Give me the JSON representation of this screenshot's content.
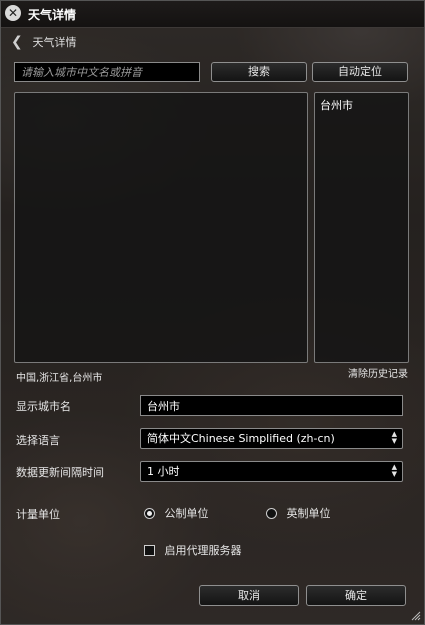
{
  "window": {
    "title": "天气详情"
  },
  "nav": {
    "back_icon": "chevron-left-icon",
    "title": "天气详情"
  },
  "search": {
    "placeholder": "请输入城市中文名或拼音",
    "search_button": "搜索",
    "locate_button": "自动定位"
  },
  "history": {
    "items": [
      "台州市"
    ],
    "clear_label": "清除历史记录"
  },
  "location": {
    "selected": "中国,浙江省,台州市"
  },
  "form": {
    "display_city_label": "显示城市名",
    "display_city_value": "台州市",
    "language_label": "选择语言",
    "language_value": "简体中文Chinese Simplified (zh-cn)",
    "interval_label": "数据更新间隔时间",
    "interval_value": "1 小时",
    "unit_label": "计量单位",
    "unit_options": [
      {
        "label": "公制单位",
        "selected": true
      },
      {
        "label": "英制单位",
        "selected": false
      }
    ],
    "proxy_label": "启用代理服务器",
    "proxy_checked": false
  },
  "footer": {
    "cancel": "取消",
    "ok": "确定"
  },
  "colors": {
    "field_bg": "#000000",
    "border": "#8a8a8a",
    "text": "#e6e6e6"
  }
}
